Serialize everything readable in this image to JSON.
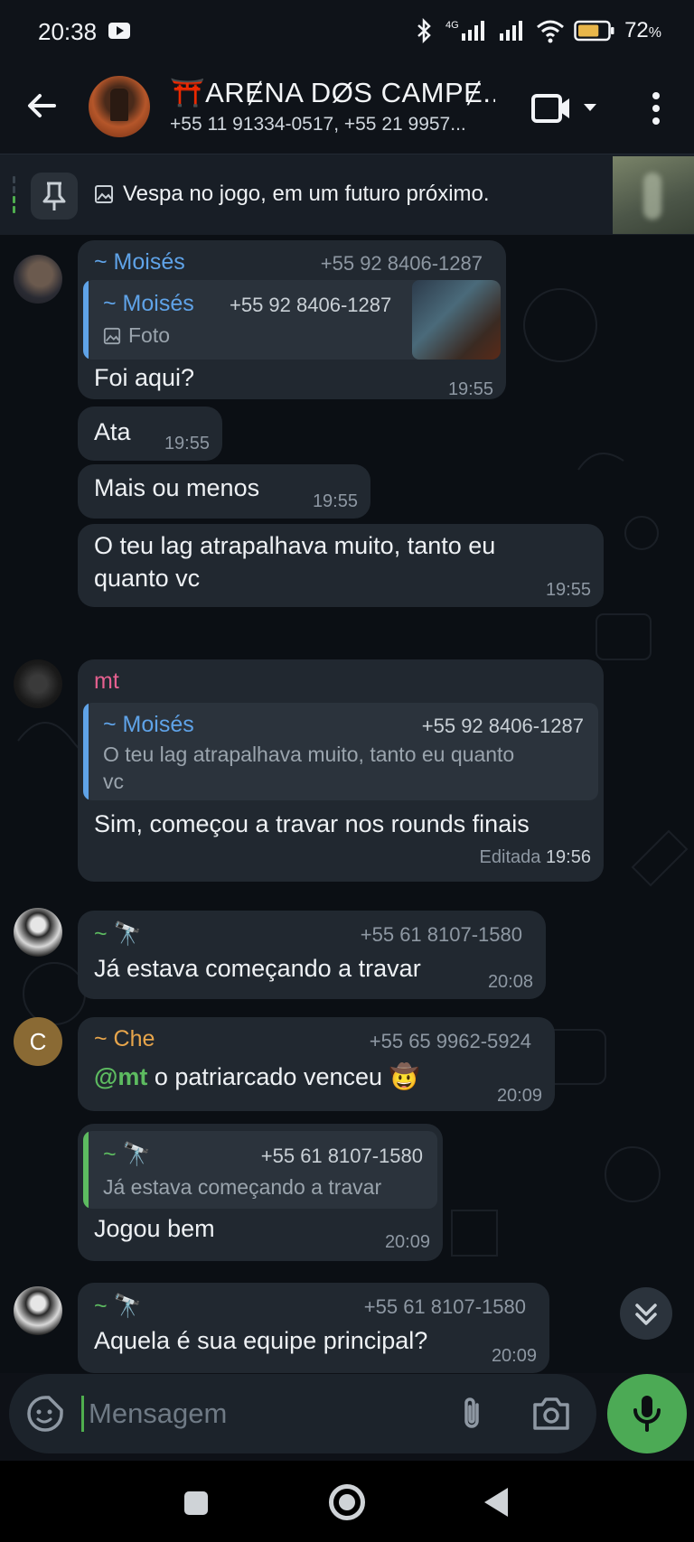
{
  "status_bar": {
    "time": "20:38",
    "network": "4G",
    "battery": "72",
    "battery_unit": "%",
    "battery_level_pct": 72
  },
  "header": {
    "title": "⛩️ARɆNA DØS CAMPɆ...",
    "subtitle": "+55 11 91334-0517, +55 21 9957..."
  },
  "pinned": {
    "text": "Vespa no jogo, em um futuro próximo."
  },
  "colors": {
    "accent": "#4fae4e",
    "bubble": "#212830",
    "link_blue": "#5fa3e8",
    "mt_pink": "#e5608f",
    "green_name": "#5dbb60",
    "che_orange": "#e7a54b"
  },
  "messages": [
    {
      "sender": "~ Moisés",
      "phone": "+55 92 8406-1287",
      "reply": {
        "sender": "~ Moisés",
        "phone": "+55 92 8406-1287",
        "text": "Foto"
      },
      "text": "Foi aqui?",
      "time": "19:55"
    },
    {
      "text": "Ata",
      "time": "19:55"
    },
    {
      "text": "Mais ou menos",
      "time": "19:55"
    },
    {
      "text_line1": "O teu lag atrapalhava muito, tanto eu",
      "text_line2": "quanto vc",
      "time": "19:55"
    },
    {
      "sender": "mt",
      "reply": {
        "sender": "~ Moisés",
        "phone": "+55 92 8406-1287",
        "text_line1": "O teu lag atrapalhava muito, tanto eu quanto",
        "text_line2": "vc"
      },
      "text": "Sim, começou a travar nos rounds finais",
      "edited": "Editada",
      "time": "19:56"
    },
    {
      "sender": "~ 🔭",
      "phone": "+55 61 8107-1580",
      "text": "Já estava começando a travar",
      "time": "20:08"
    },
    {
      "sender": "~ Che",
      "avatar_letter": "C",
      "phone": "+55 65 9962-5924",
      "mention": "@mt",
      "text": "o patriarcado venceu 🤠",
      "time": "20:09"
    },
    {
      "reply": {
        "sender": "~ 🔭",
        "phone": "+55 61 8107-1580",
        "text": "Já estava começando a travar"
      },
      "text": "Jogou bem",
      "time": "20:09"
    },
    {
      "sender": "~ 🔭",
      "phone": "+55 61 8107-1580",
      "text": "Aquela é sua equipe principal?",
      "time": "20:09"
    }
  ],
  "input": {
    "placeholder": "Mensagem"
  }
}
